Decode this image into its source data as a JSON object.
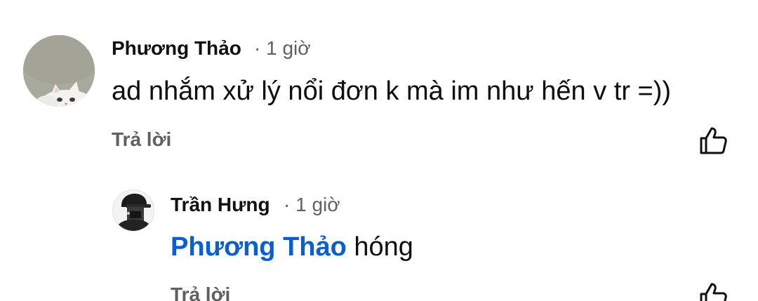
{
  "comments": [
    {
      "author": "Phương Thảo",
      "time": "· 1 giờ",
      "text": "ad nhắm xử lý nổi đơn k mà im như hến v tr =))",
      "reply_label": "Trả lời",
      "like_icon": "thumbs-up-icon"
    }
  ],
  "replies": [
    {
      "author": "Trần Hưng",
      "time": "· 1 giờ",
      "mention": "Phương Thảo",
      "text": " hóng",
      "reply_label": "Trả lời",
      "like_icon": "thumbs-up-icon"
    }
  ]
}
